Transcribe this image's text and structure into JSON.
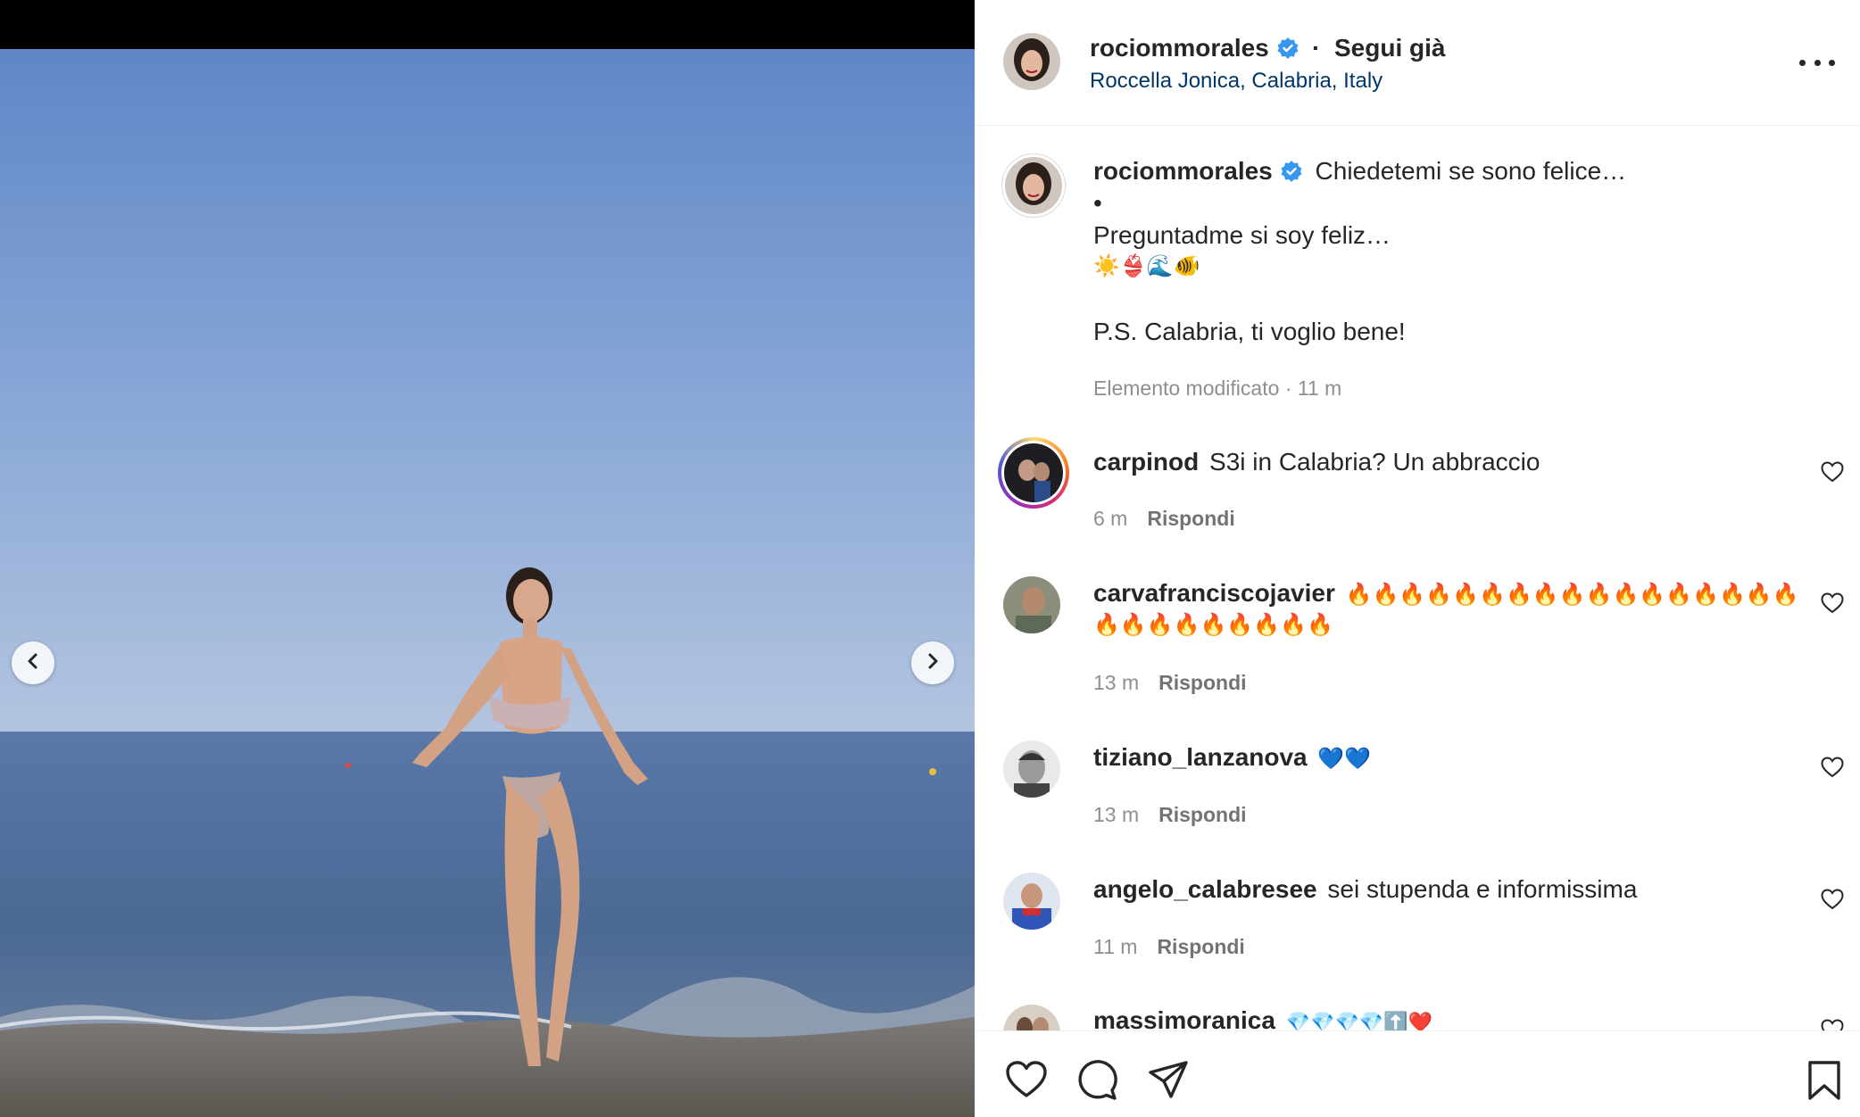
{
  "post": {
    "username": "rociommorales",
    "follow_status": "Segui già",
    "location": "Roccella Jonica, Calabria, Italy",
    "caption_line1": "Chiedetemi se sono felice…",
    "caption_dot": "•",
    "caption_line2": "Preguntadme si soy feliz…",
    "caption_emoji": "☀️👙🌊🐠",
    "caption_ps": "P.S. Calabria, ti voglio bene!",
    "edited_label": "Elemento modificato",
    "edited_time": "11 m"
  },
  "comments": [
    {
      "username": "carpinod",
      "text": "S3i in Calabria? Un abbraccio",
      "time": "6 m",
      "reply": "Rispondi"
    },
    {
      "username": "carvafranciscojavier",
      "text": "🔥🔥🔥🔥🔥🔥🔥🔥🔥🔥🔥🔥🔥🔥🔥🔥🔥",
      "text2": "🔥🔥🔥🔥🔥🔥🔥🔥🔥",
      "time": "13 m",
      "reply": "Rispondi"
    },
    {
      "username": "tiziano_lanzanova",
      "text": "💙💙",
      "time": "13 m",
      "reply": "Rispondi"
    },
    {
      "username": "angelo_calabresee",
      "text": "sei stupenda e informissima",
      "time": "11 m",
      "reply": "Rispondi"
    },
    {
      "username": "massimoranica",
      "text": "💎💎💎💎⬆️❤️"
    }
  ],
  "icons": {
    "verified": "verified-badge-icon",
    "more": "more-options-icon",
    "like": "heart-icon",
    "comment": "comment-icon",
    "share": "share-icon",
    "save": "bookmark-icon",
    "prev": "chevron-left-icon",
    "next": "chevron-right-icon"
  },
  "colors": {
    "verified_blue": "#3897f0",
    "location_link": "#00376b",
    "muted": "#8e8e8e"
  }
}
